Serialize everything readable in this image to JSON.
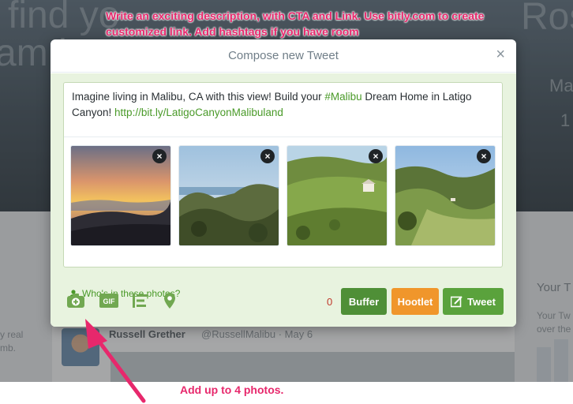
{
  "background": {
    "hero_line1": "find yo",
    "hero_line2": "am h",
    "hero_right": "Ros",
    "hero_small1": "Mali",
    "hero_small2": "1",
    "feed_name": "Russell Grether",
    "feed_handle": "@RussellMalibu · May 6",
    "side_title": "Your T",
    "side_body1": "Your Tw",
    "side_body2": "over the",
    "left_text1": "y real",
    "left_text2": "mb."
  },
  "modal": {
    "title": "Compose new Tweet",
    "close_glyph": "×"
  },
  "tweet": {
    "text_before": "Imagine living in Malibu, CA with this view! Build your ",
    "hashtag": "#Malibu",
    "text_after": " Dream Home in Latigo Canyon! ",
    "link": "http://bit.ly/LatigoCanyonMalibuland"
  },
  "photos": [
    {
      "description": "sunset-over-hills",
      "remove_glyph": "×"
    },
    {
      "description": "ocean-view-from-canyon",
      "remove_glyph": "×"
    },
    {
      "description": "green-hillside-with-house",
      "remove_glyph": "×"
    },
    {
      "description": "canyon-valley-view",
      "remove_glyph": "×"
    }
  ],
  "who_in_photos": "Who's in these photos?",
  "toolbar": {
    "icons": [
      "camera-icon",
      "gif-icon",
      "poll-icon",
      "location-icon"
    ],
    "gif_label": "GIF"
  },
  "char_counter": "0",
  "buttons": {
    "buffer": "Buffer",
    "hootlet": "Hootlet",
    "tweet": "Tweet"
  },
  "annotations": {
    "top": "Write an exciting description, with CTA and Link. Use bitly.com to create customized link. Add hashtags if you have room",
    "bottom": "Add up to 4 photos."
  },
  "colors": {
    "annotation": "#e7286c",
    "accent_green": "#5aa23c",
    "buffer_green": "#4f8f37",
    "hootlet_orange": "#f0962b",
    "link_green": "#4a9a29",
    "compose_bg": "#e8f3df"
  }
}
